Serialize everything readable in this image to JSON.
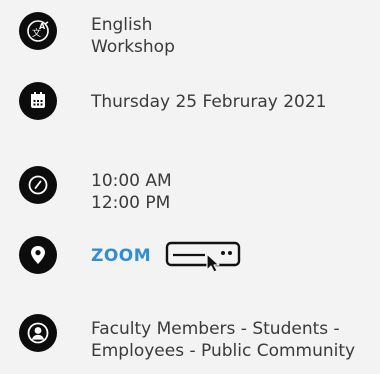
{
  "language": {
    "icon": "translate-icon",
    "line1": "English",
    "line2": "Workshop"
  },
  "date": {
    "icon": "calendar-icon",
    "text": "Thursday 25 Februray 2021"
  },
  "time": {
    "icon": "clock-icon",
    "start": "10:00 AM",
    "end": "12:00 PM"
  },
  "location": {
    "icon": "map-pin-icon",
    "link_label": "ZOOM",
    "link_icon": "click-button-icon",
    "link_color": "#2f8fd0"
  },
  "audience": {
    "icon": "user-circle-icon",
    "line1": "Faculty Members - Students -",
    "line2": "Employees - Public Community"
  },
  "colors": {
    "icon_bg": "#0c0c0c",
    "text": "#3a3a3a",
    "background": "#f3f3f3"
  }
}
